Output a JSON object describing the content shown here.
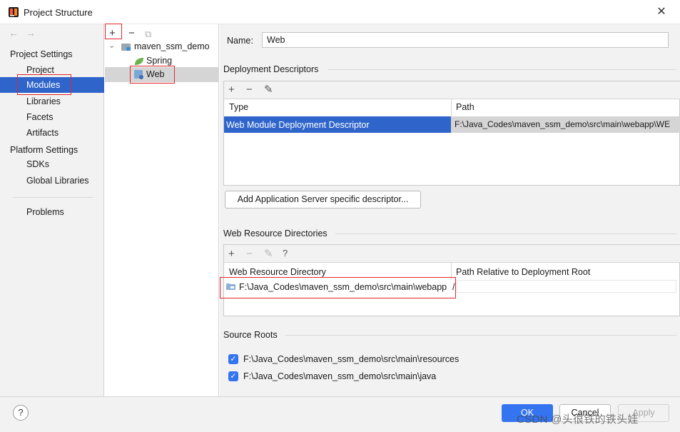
{
  "window": {
    "title": "Project Structure",
    "close": "✕"
  },
  "nav": {
    "back": "←",
    "forward": "→",
    "project_settings": "Project Settings",
    "project_items": [
      "Project",
      "Modules",
      "Libraries",
      "Facets",
      "Artifacts"
    ],
    "platform_settings": "Platform Settings",
    "platform_items": [
      "SDKs",
      "Global Libraries"
    ],
    "problems": "Problems",
    "selected": "Modules"
  },
  "tree": {
    "add": "+",
    "remove": "−",
    "copy": "⧉",
    "root": "maven_ssm_demo",
    "children": [
      "Spring",
      "Web"
    ],
    "expand_glyph": "⌄"
  },
  "detail": {
    "name_label": "Name:",
    "name_value": "Web",
    "deployment": {
      "title": "Deployment Descriptors",
      "toolbar": [
        "+",
        "−",
        "✎"
      ],
      "columns": [
        "Type",
        "Path"
      ],
      "rows": [
        {
          "type": "Web Module Deployment Descriptor",
          "path": "F:\\Java_Codes\\maven_ssm_demo\\src\\main\\webapp\\WE"
        }
      ],
      "add_button": "Add Application Server specific descriptor..."
    },
    "web_resources": {
      "title": "Web Resource Directories",
      "toolbar": [
        "+",
        "−",
        "✎",
        "?"
      ],
      "columns": [
        "Web Resource Directory",
        "Path Relative to Deployment Root"
      ],
      "rows": [
        {
          "directory": "F:\\Java_Codes\\maven_ssm_demo\\src\\main\\webapp",
          "relative": "/"
        }
      ]
    },
    "source_roots": {
      "title": "Source Roots",
      "items": [
        {
          "path": "F:\\Java_Codes\\maven_ssm_demo\\src\\main\\resources",
          "checked": true
        },
        {
          "path": "F:\\Java_Codes\\maven_ssm_demo\\src\\main\\java",
          "checked": true
        }
      ]
    }
  },
  "footer": {
    "help": "?",
    "ok": "OK",
    "cancel": "Cancel",
    "apply": "Apply",
    "watermark": "CSDN @头很铁的铁头娃"
  },
  "colors": {
    "selection": "#2f65ca",
    "primary_button": "#3574f0",
    "highlight_box": "#e0262d",
    "panel_bg": "#f2f2f2"
  }
}
